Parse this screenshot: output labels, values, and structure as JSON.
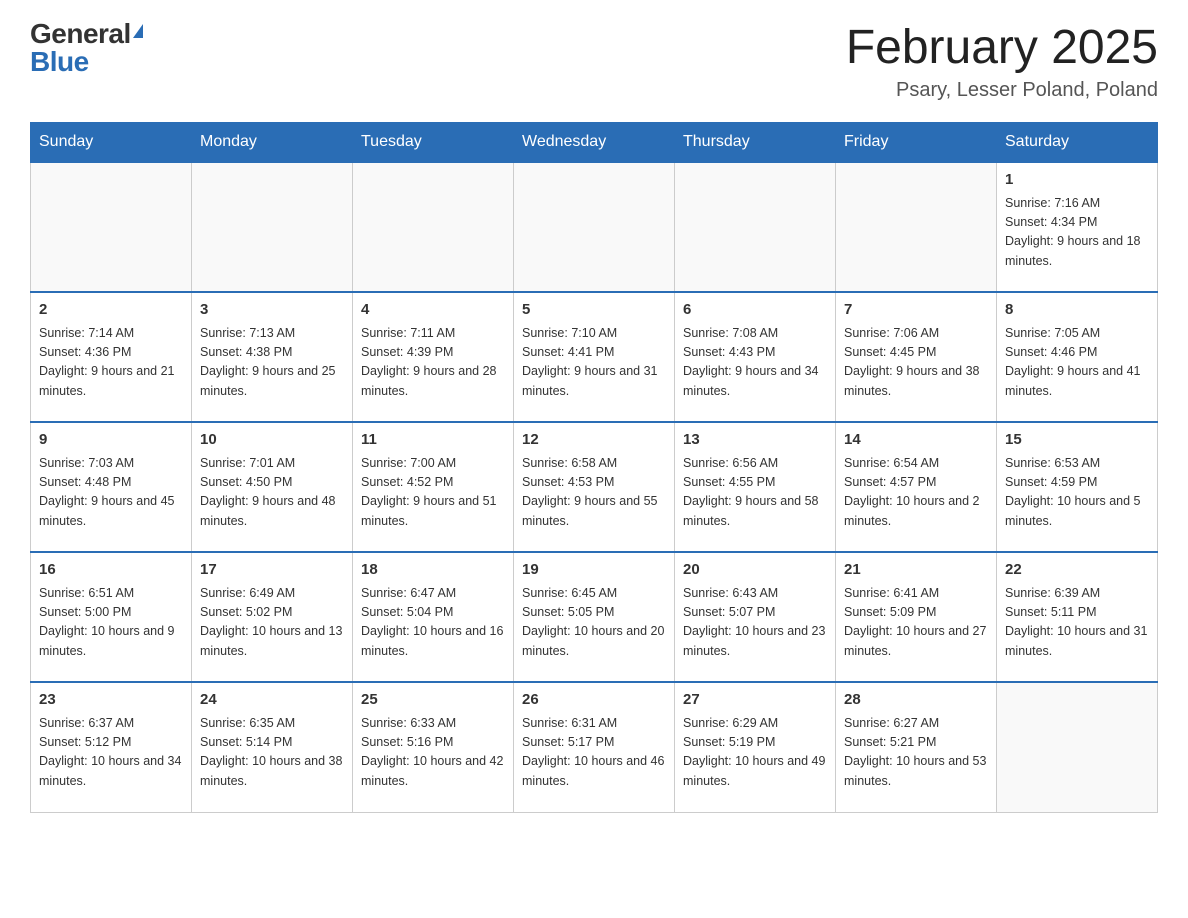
{
  "logo": {
    "general": "General",
    "blue": "Blue"
  },
  "title": "February 2025",
  "location": "Psary, Lesser Poland, Poland",
  "days_of_week": [
    "Sunday",
    "Monday",
    "Tuesday",
    "Wednesday",
    "Thursday",
    "Friday",
    "Saturday"
  ],
  "weeks": [
    [
      {
        "day": "",
        "info": ""
      },
      {
        "day": "",
        "info": ""
      },
      {
        "day": "",
        "info": ""
      },
      {
        "day": "",
        "info": ""
      },
      {
        "day": "",
        "info": ""
      },
      {
        "day": "",
        "info": ""
      },
      {
        "day": "1",
        "info": "Sunrise: 7:16 AM\nSunset: 4:34 PM\nDaylight: 9 hours and 18 minutes."
      }
    ],
    [
      {
        "day": "2",
        "info": "Sunrise: 7:14 AM\nSunset: 4:36 PM\nDaylight: 9 hours and 21 minutes."
      },
      {
        "day": "3",
        "info": "Sunrise: 7:13 AM\nSunset: 4:38 PM\nDaylight: 9 hours and 25 minutes."
      },
      {
        "day": "4",
        "info": "Sunrise: 7:11 AM\nSunset: 4:39 PM\nDaylight: 9 hours and 28 minutes."
      },
      {
        "day": "5",
        "info": "Sunrise: 7:10 AM\nSunset: 4:41 PM\nDaylight: 9 hours and 31 minutes."
      },
      {
        "day": "6",
        "info": "Sunrise: 7:08 AM\nSunset: 4:43 PM\nDaylight: 9 hours and 34 minutes."
      },
      {
        "day": "7",
        "info": "Sunrise: 7:06 AM\nSunset: 4:45 PM\nDaylight: 9 hours and 38 minutes."
      },
      {
        "day": "8",
        "info": "Sunrise: 7:05 AM\nSunset: 4:46 PM\nDaylight: 9 hours and 41 minutes."
      }
    ],
    [
      {
        "day": "9",
        "info": "Sunrise: 7:03 AM\nSunset: 4:48 PM\nDaylight: 9 hours and 45 minutes."
      },
      {
        "day": "10",
        "info": "Sunrise: 7:01 AM\nSunset: 4:50 PM\nDaylight: 9 hours and 48 minutes."
      },
      {
        "day": "11",
        "info": "Sunrise: 7:00 AM\nSunset: 4:52 PM\nDaylight: 9 hours and 51 minutes."
      },
      {
        "day": "12",
        "info": "Sunrise: 6:58 AM\nSunset: 4:53 PM\nDaylight: 9 hours and 55 minutes."
      },
      {
        "day": "13",
        "info": "Sunrise: 6:56 AM\nSunset: 4:55 PM\nDaylight: 9 hours and 58 minutes."
      },
      {
        "day": "14",
        "info": "Sunrise: 6:54 AM\nSunset: 4:57 PM\nDaylight: 10 hours and 2 minutes."
      },
      {
        "day": "15",
        "info": "Sunrise: 6:53 AM\nSunset: 4:59 PM\nDaylight: 10 hours and 5 minutes."
      }
    ],
    [
      {
        "day": "16",
        "info": "Sunrise: 6:51 AM\nSunset: 5:00 PM\nDaylight: 10 hours and 9 minutes."
      },
      {
        "day": "17",
        "info": "Sunrise: 6:49 AM\nSunset: 5:02 PM\nDaylight: 10 hours and 13 minutes."
      },
      {
        "day": "18",
        "info": "Sunrise: 6:47 AM\nSunset: 5:04 PM\nDaylight: 10 hours and 16 minutes."
      },
      {
        "day": "19",
        "info": "Sunrise: 6:45 AM\nSunset: 5:05 PM\nDaylight: 10 hours and 20 minutes."
      },
      {
        "day": "20",
        "info": "Sunrise: 6:43 AM\nSunset: 5:07 PM\nDaylight: 10 hours and 23 minutes."
      },
      {
        "day": "21",
        "info": "Sunrise: 6:41 AM\nSunset: 5:09 PM\nDaylight: 10 hours and 27 minutes."
      },
      {
        "day": "22",
        "info": "Sunrise: 6:39 AM\nSunset: 5:11 PM\nDaylight: 10 hours and 31 minutes."
      }
    ],
    [
      {
        "day": "23",
        "info": "Sunrise: 6:37 AM\nSunset: 5:12 PM\nDaylight: 10 hours and 34 minutes."
      },
      {
        "day": "24",
        "info": "Sunrise: 6:35 AM\nSunset: 5:14 PM\nDaylight: 10 hours and 38 minutes."
      },
      {
        "day": "25",
        "info": "Sunrise: 6:33 AM\nSunset: 5:16 PM\nDaylight: 10 hours and 42 minutes."
      },
      {
        "day": "26",
        "info": "Sunrise: 6:31 AM\nSunset: 5:17 PM\nDaylight: 10 hours and 46 minutes."
      },
      {
        "day": "27",
        "info": "Sunrise: 6:29 AM\nSunset: 5:19 PM\nDaylight: 10 hours and 49 minutes."
      },
      {
        "day": "28",
        "info": "Sunrise: 6:27 AM\nSunset: 5:21 PM\nDaylight: 10 hours and 53 minutes."
      },
      {
        "day": "",
        "info": ""
      }
    ]
  ]
}
